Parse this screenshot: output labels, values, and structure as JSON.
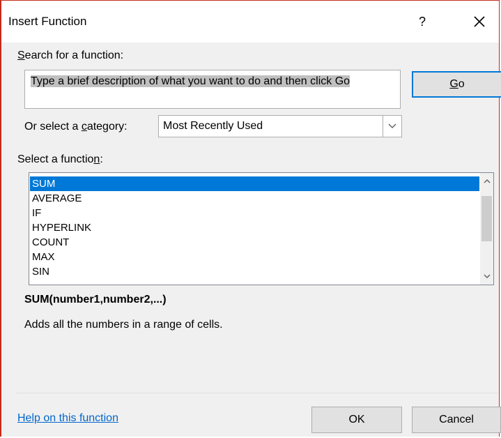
{
  "dialog": {
    "title": "Insert Function",
    "help_glyph": "?",
    "close_glyph": "×"
  },
  "search": {
    "label_pre": "",
    "label_key": "S",
    "label_post": "earch for a function:",
    "value": "Type a brief description of what you want to do and then click Go",
    "go_pre": "",
    "go_key": "G",
    "go_post": "o"
  },
  "category": {
    "label_pre": "Or select a ",
    "label_key": "c",
    "label_post": "ategory:",
    "selected": "Most Recently Used"
  },
  "functions": {
    "label_pre": "Select a functio",
    "label_key": "n",
    "label_post": ":",
    "items": [
      "SUM",
      "AVERAGE",
      "IF",
      "HYPERLINK",
      "COUNT",
      "MAX",
      "SIN"
    ],
    "selected_index": 0
  },
  "details": {
    "syntax": "SUM(number1,number2,...)",
    "description": "Adds all the numbers in a range of cells."
  },
  "footer": {
    "help_link": "Help on this function",
    "ok_label": "OK",
    "cancel_label": "Cancel"
  },
  "colors": {
    "accent": "#0078d7",
    "link": "#0066cc",
    "window_border": "#c42b1c"
  }
}
